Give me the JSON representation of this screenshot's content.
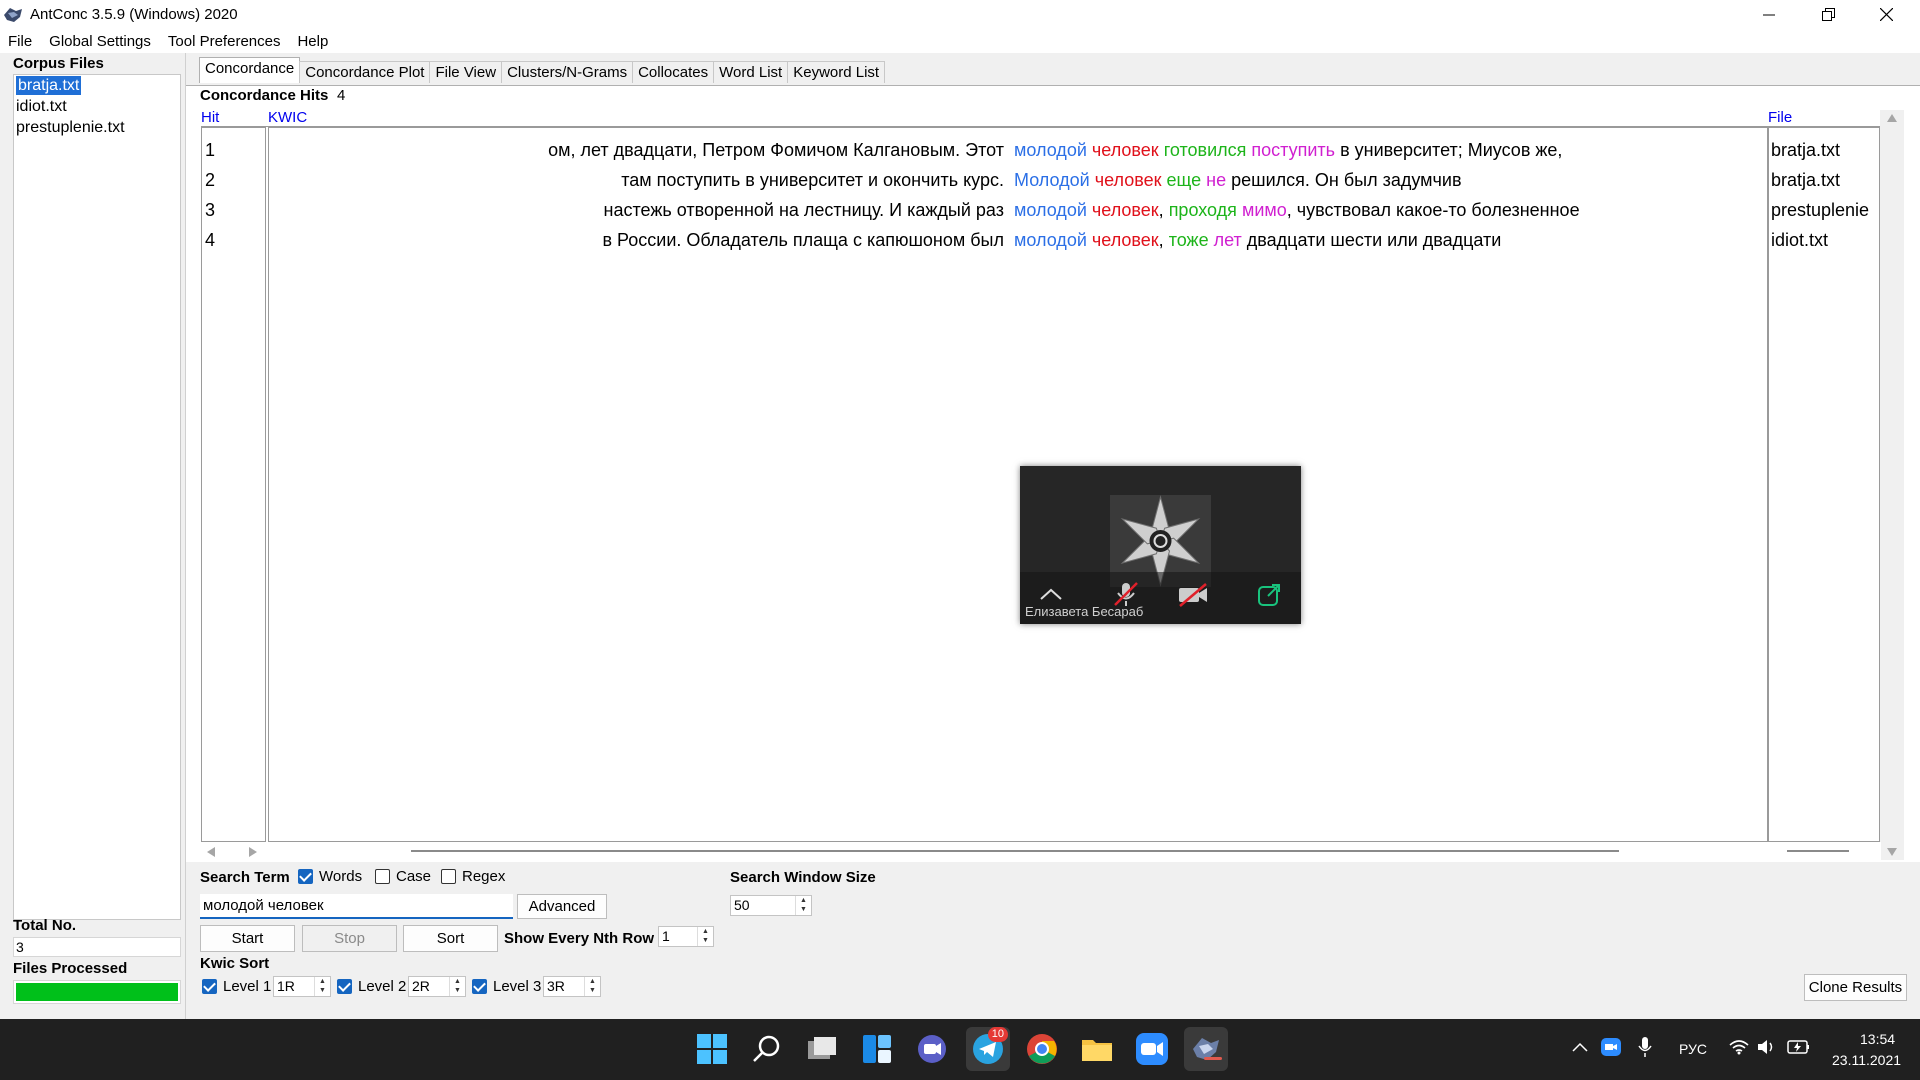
{
  "window": {
    "title": "AntConc 3.5.9 (Windows) 2020"
  },
  "menu": [
    "File",
    "Global Settings",
    "Tool Preferences",
    "Help"
  ],
  "left": {
    "corpus_files_label": "Corpus Files",
    "files": [
      "bratja.txt",
      "idiot.txt",
      "prestuplenie.txt"
    ],
    "total_label": "Total No.",
    "total_value": "3",
    "files_processed_label": "Files Processed",
    "progress": 1.0,
    "progress_color": "#00c01a"
  },
  "tabs": [
    "Concordance",
    "Concordance Plot",
    "File View",
    "Clusters/N-Grams",
    "Collocates",
    "Word List",
    "Keyword List"
  ],
  "hits": {
    "label": "Concordance Hits",
    "count": "4"
  },
  "columns": {
    "hit": "Hit",
    "kwic": "KWIC",
    "file": "File"
  },
  "colors": {
    "blue": "#2b6fe6",
    "red": "#e0101a",
    "green": "#1db41a",
    "magenta": "#d020d0",
    "link": "#0000ee"
  },
  "rows": [
    {
      "hit": "1",
      "left": "ом, лет двадцати, Петром Фомичом Калгановым. Этот",
      "right": [
        {
          "t": "молодой",
          "c": "blue"
        },
        {
          "t": " "
        },
        {
          "t": "человек",
          "c": "red"
        },
        {
          "t": " "
        },
        {
          "t": "готовился",
          "c": "green"
        },
        {
          "t": " "
        },
        {
          "t": "поступить",
          "c": "magenta"
        },
        {
          "t": " в университет; Миусов же,"
        }
      ],
      "file": "bratja.txt"
    },
    {
      "hit": "2",
      "left": "там поступить в университет и окончить курс.",
      "right": [
        {
          "t": "Молодой",
          "c": "blue"
        },
        {
          "t": " "
        },
        {
          "t": "человек",
          "c": "red"
        },
        {
          "t": " "
        },
        {
          "t": "еще",
          "c": "green"
        },
        {
          "t": " "
        },
        {
          "t": "не",
          "c": "magenta"
        },
        {
          "t": " решился. Он был задумчив"
        }
      ],
      "file": "bratja.txt"
    },
    {
      "hit": "3",
      "left": "настежь отворенной на лестницу. И каждый раз",
      "right": [
        {
          "t": "молодой",
          "c": "blue"
        },
        {
          "t": " "
        },
        {
          "t": "человек",
          "c": "red"
        },
        {
          "t": ", "
        },
        {
          "t": "проходя",
          "c": "green"
        },
        {
          "t": " "
        },
        {
          "t": "мимо",
          "c": "magenta"
        },
        {
          "t": ", чувствовал какое-то болезненное"
        }
      ],
      "file": "prestuplenie"
    },
    {
      "hit": "4",
      "left": "в России. Обладатель плаща с капюшоном был",
      "right": [
        {
          "t": "молодой",
          "c": "blue"
        },
        {
          "t": " "
        },
        {
          "t": "человек",
          "c": "red"
        },
        {
          "t": ", "
        },
        {
          "t": "тоже",
          "c": "green"
        },
        {
          "t": " "
        },
        {
          "t": "лет",
          "c": "magenta"
        },
        {
          "t": " двадцати шести или двадцати"
        }
      ],
      "file": "idiot.txt"
    }
  ],
  "search": {
    "term_label": "Search Term",
    "words_label": "Words",
    "words_checked": true,
    "case_label": "Case",
    "case_checked": false,
    "regex_label": "Regex",
    "regex_checked": false,
    "value": "молодой человек",
    "advanced_label": "Advanced",
    "start_label": "Start",
    "stop_label": "Stop",
    "sort_label": "Sort",
    "nth_row_label": "Show Every Nth Row",
    "nth_row_value": "1",
    "window_size_label": "Search Window Size",
    "window_size_value": "50"
  },
  "kwic_sort": {
    "label": "Kwic Sort",
    "levels": [
      {
        "label": "Level 1",
        "value": "1R",
        "checked": true
      },
      {
        "label": "Level 2",
        "value": "2R",
        "checked": true
      },
      {
        "label": "Level 3",
        "value": "3R",
        "checked": true
      }
    ],
    "clone_label": "Clone Results"
  },
  "popup": {
    "name": "Елизавета Бесараб"
  },
  "taskbar": {
    "telegram_badge": "10",
    "lang": "РУС",
    "time": "13:54",
    "date": "23.11.2021"
  }
}
